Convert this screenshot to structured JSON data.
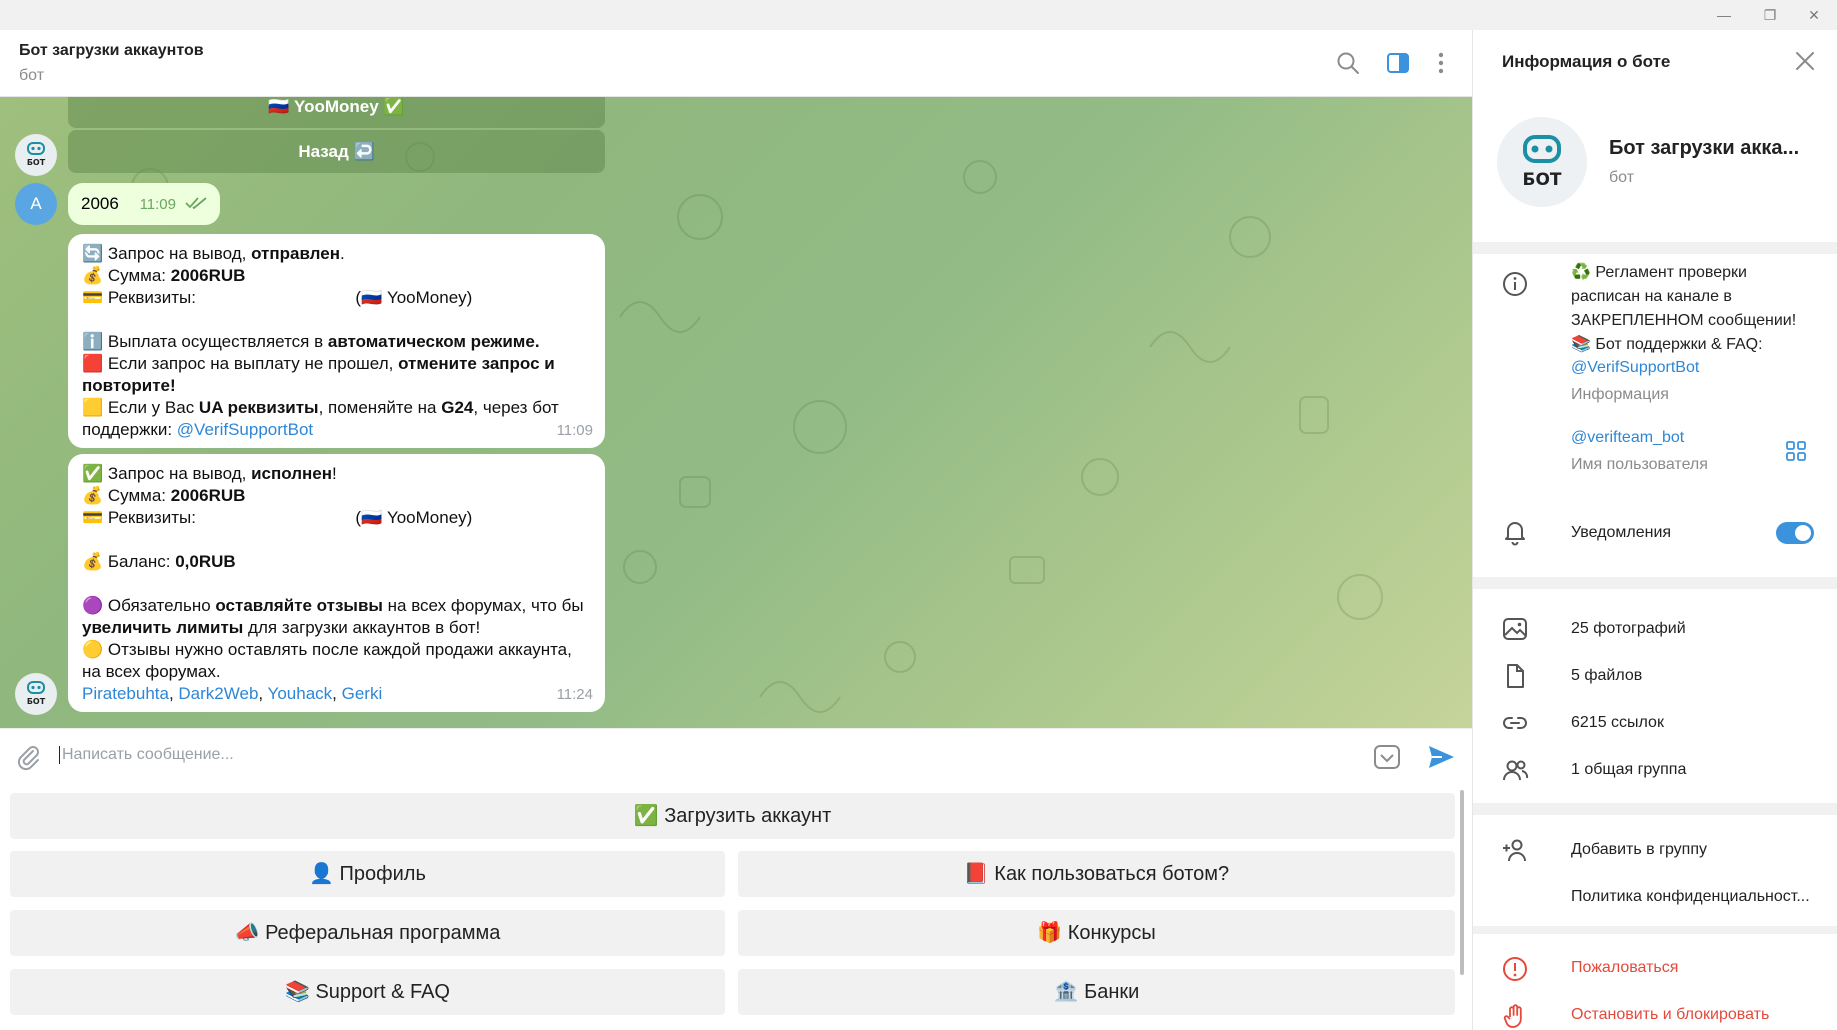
{
  "window": {
    "minimize_glyph": "—",
    "maximize_glyph": "❐",
    "close_glyph": "✕"
  },
  "header": {
    "title": "Бот загрузки аккаунтов",
    "status": "бот",
    "icons": [
      "search-icon",
      "sidebar-toggle-icon",
      "more-icon"
    ]
  },
  "chat": {
    "old_buttons": [
      {
        "label": "🇷🇺 YooMoney ✅"
      },
      {
        "label": "Назад ↩️"
      }
    ],
    "bot_avatar_text": "БОТ",
    "user_avatar_letter": "A",
    "outgoing": {
      "text": "2006",
      "time": "11:09"
    },
    "msg1": {
      "l1a": "🔄 Запрос на вывод, ",
      "l1b": "отправлен",
      "l1c": ".",
      "l2a": "💰 Сумма: ",
      "l2b": "2006RUB",
      "l3a": "💳 Реквизиты: ",
      "l3b": "(🇷🇺 YooMoney)",
      "l4a": "ℹ️ Выплата осуществляется в ",
      "l4b": "автоматическом режиме.",
      "l5a": "🟥 Если запрос на выплату не прошел, ",
      "l5b": "отмените запрос и повторите!",
      "l6a": "🟨 Если у Вас ",
      "l6b": "UA реквизиты",
      "l6c": ", поменяйте на ",
      "l6d": "G24",
      "l6e": ", через бот поддержки: ",
      "l6link": "@VerifSupportBot",
      "time": "11:09"
    },
    "msg2": {
      "l1a": "✅ Запрос на вывод, ",
      "l1b": "исполнен",
      "l1c": "!",
      "l2a": "💰 Сумма: ",
      "l2b": "2006RUB",
      "l3a": "💳 Реквизиты: ",
      "l3b": "(🇷🇺 YooMoney)",
      "l4a": "💰 Баланс: ",
      "l4b": "0,0RUB",
      "l5a": "🟣 Обязательно ",
      "l5b": "оставляйте отзывы",
      "l5c": " на всех форумах, что бы ",
      "l5d": "увеличить лимиты",
      "l5e": " для загрузки аккаунтов в бот!",
      "l6": "🟡 Отзывы нужно оставлять после каждой продажи аккаунта, на всех форумах.",
      "links": [
        "Piratebuhta",
        "Dark2Web",
        "Youhack",
        "Gerki"
      ],
      "time": "11:24"
    }
  },
  "composer": {
    "placeholder": "Написать сообщение..."
  },
  "keyboard": {
    "buttons": [
      {
        "label": "✅ Загрузить аккаунт"
      },
      {
        "label": "👤 Профиль"
      },
      {
        "label": "📕 Как пользоваться ботом?"
      },
      {
        "label": "📣 Реферальная программа"
      },
      {
        "label": "🎁 Конкурсы"
      },
      {
        "label": "📚 Support & FAQ"
      },
      {
        "label": "🏦 Банки"
      }
    ]
  },
  "side": {
    "title": "Информация о боте",
    "name": "Бот загрузки акка...",
    "sub": "бот",
    "about_lines": [
      "♻️ Регламент проверки",
      "расписан на канале в",
      "ЗАКРЕПЛЕННОМ сообщении!",
      "📚 Бот поддержки & FAQ:"
    ],
    "about_link": "@VerifSupportBot",
    "about_caption": "Информация",
    "username": "@verifteam_bot",
    "username_caption": "Имя пользователя",
    "notifications": "Уведомления",
    "notifications_on": true,
    "media": [
      {
        "icon": "photo-icon",
        "label": "25 фотографий"
      },
      {
        "icon": "file-icon",
        "label": "5 файлов"
      },
      {
        "icon": "link-icon",
        "label": "6215 ссылок"
      },
      {
        "icon": "group-icon",
        "label": "1 общая группа"
      }
    ],
    "add_to_group": "Добавить в группу",
    "privacy": "Политика конфиденциальност...",
    "report": "Пожаловаться",
    "block": "Остановить и блокировать"
  }
}
